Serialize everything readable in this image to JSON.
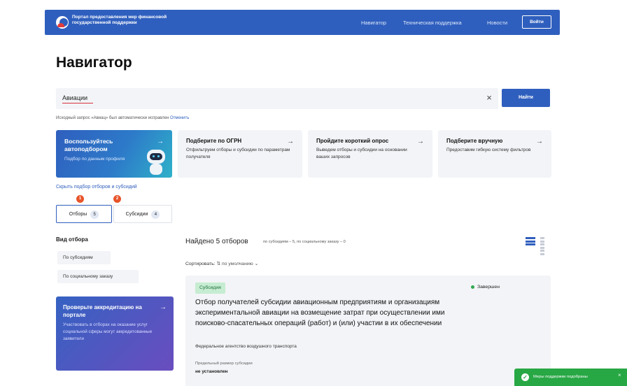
{
  "header": {
    "brand_line1": "Портал предоставления мер финансовой",
    "brand_line2": "государственной поддержки",
    "nav": [
      "Навигатор",
      "Техническая поддержка",
      "Новости"
    ],
    "login": "Войти",
    "bar_color": "#2f5fbe"
  },
  "page_title": "Навигатор",
  "search": {
    "value": "Авиации",
    "clear_icon": "×",
    "button": "Найти"
  },
  "hint": {
    "text": "Исходный запрос «Авиац» был автоматически исправлен",
    "cancel": "Отменить"
  },
  "cards": [
    {
      "title": "Воспользуйтесь автоподбором",
      "text": "Подбор по данным профиля",
      "arrow": "→"
    },
    {
      "title": "Подберите по ОГРН",
      "text": "Отфильтруем отборы и субсидии по параметрам получателя",
      "arrow": "→"
    },
    {
      "title": "Пройдите короткий опрос",
      "text": "Выведем отборы и субсидии на основании ваших запросов",
      "arrow": "→"
    },
    {
      "title": "Подберите вручную",
      "text": "Предоставим гибкую систему фильтров",
      "arrow": "→"
    }
  ],
  "hide_link": "Скрыть подбор отборов и субсидий",
  "tabs": [
    {
      "label": "Отборы",
      "count": "5",
      "badge": "1"
    },
    {
      "label": "Субсидии",
      "count": "4",
      "badge": "2"
    }
  ],
  "filters": {
    "title": "Вид отбора",
    "chips": [
      "По субсидиям",
      "По социальному заказу"
    ]
  },
  "promo": {
    "title": "Проверьте аккредитацию на портале",
    "text": "Участвовать в отборах на оказание услуг социальной сферы могут аккредитованные заявители",
    "arrow": "→"
  },
  "results": {
    "found": "Найдено 5 отборов",
    "found_sub": "по субсидиям – 5, по социальному заказу – 0",
    "sort_label": "Сортировать:",
    "sort_value": "⇅ по умолчанию ⌄"
  },
  "result_card": {
    "tag": "Субсидия",
    "status": "Завершен",
    "title": "Отбор получателей субсидии авиационным предприятиям и организациям экспериментальной авиации на возмещение затрат при осуществлении ими поисково-спасательных операций (работ) и (или) участии в их обеспечении",
    "agency": "Федеральное агентство воздушного транспорта",
    "max_label": "Предельный размер субсидии",
    "max_value": "не установлен"
  },
  "toast": {
    "icon": "✓",
    "text": "Меры поддержки подобраны",
    "close": "×"
  }
}
